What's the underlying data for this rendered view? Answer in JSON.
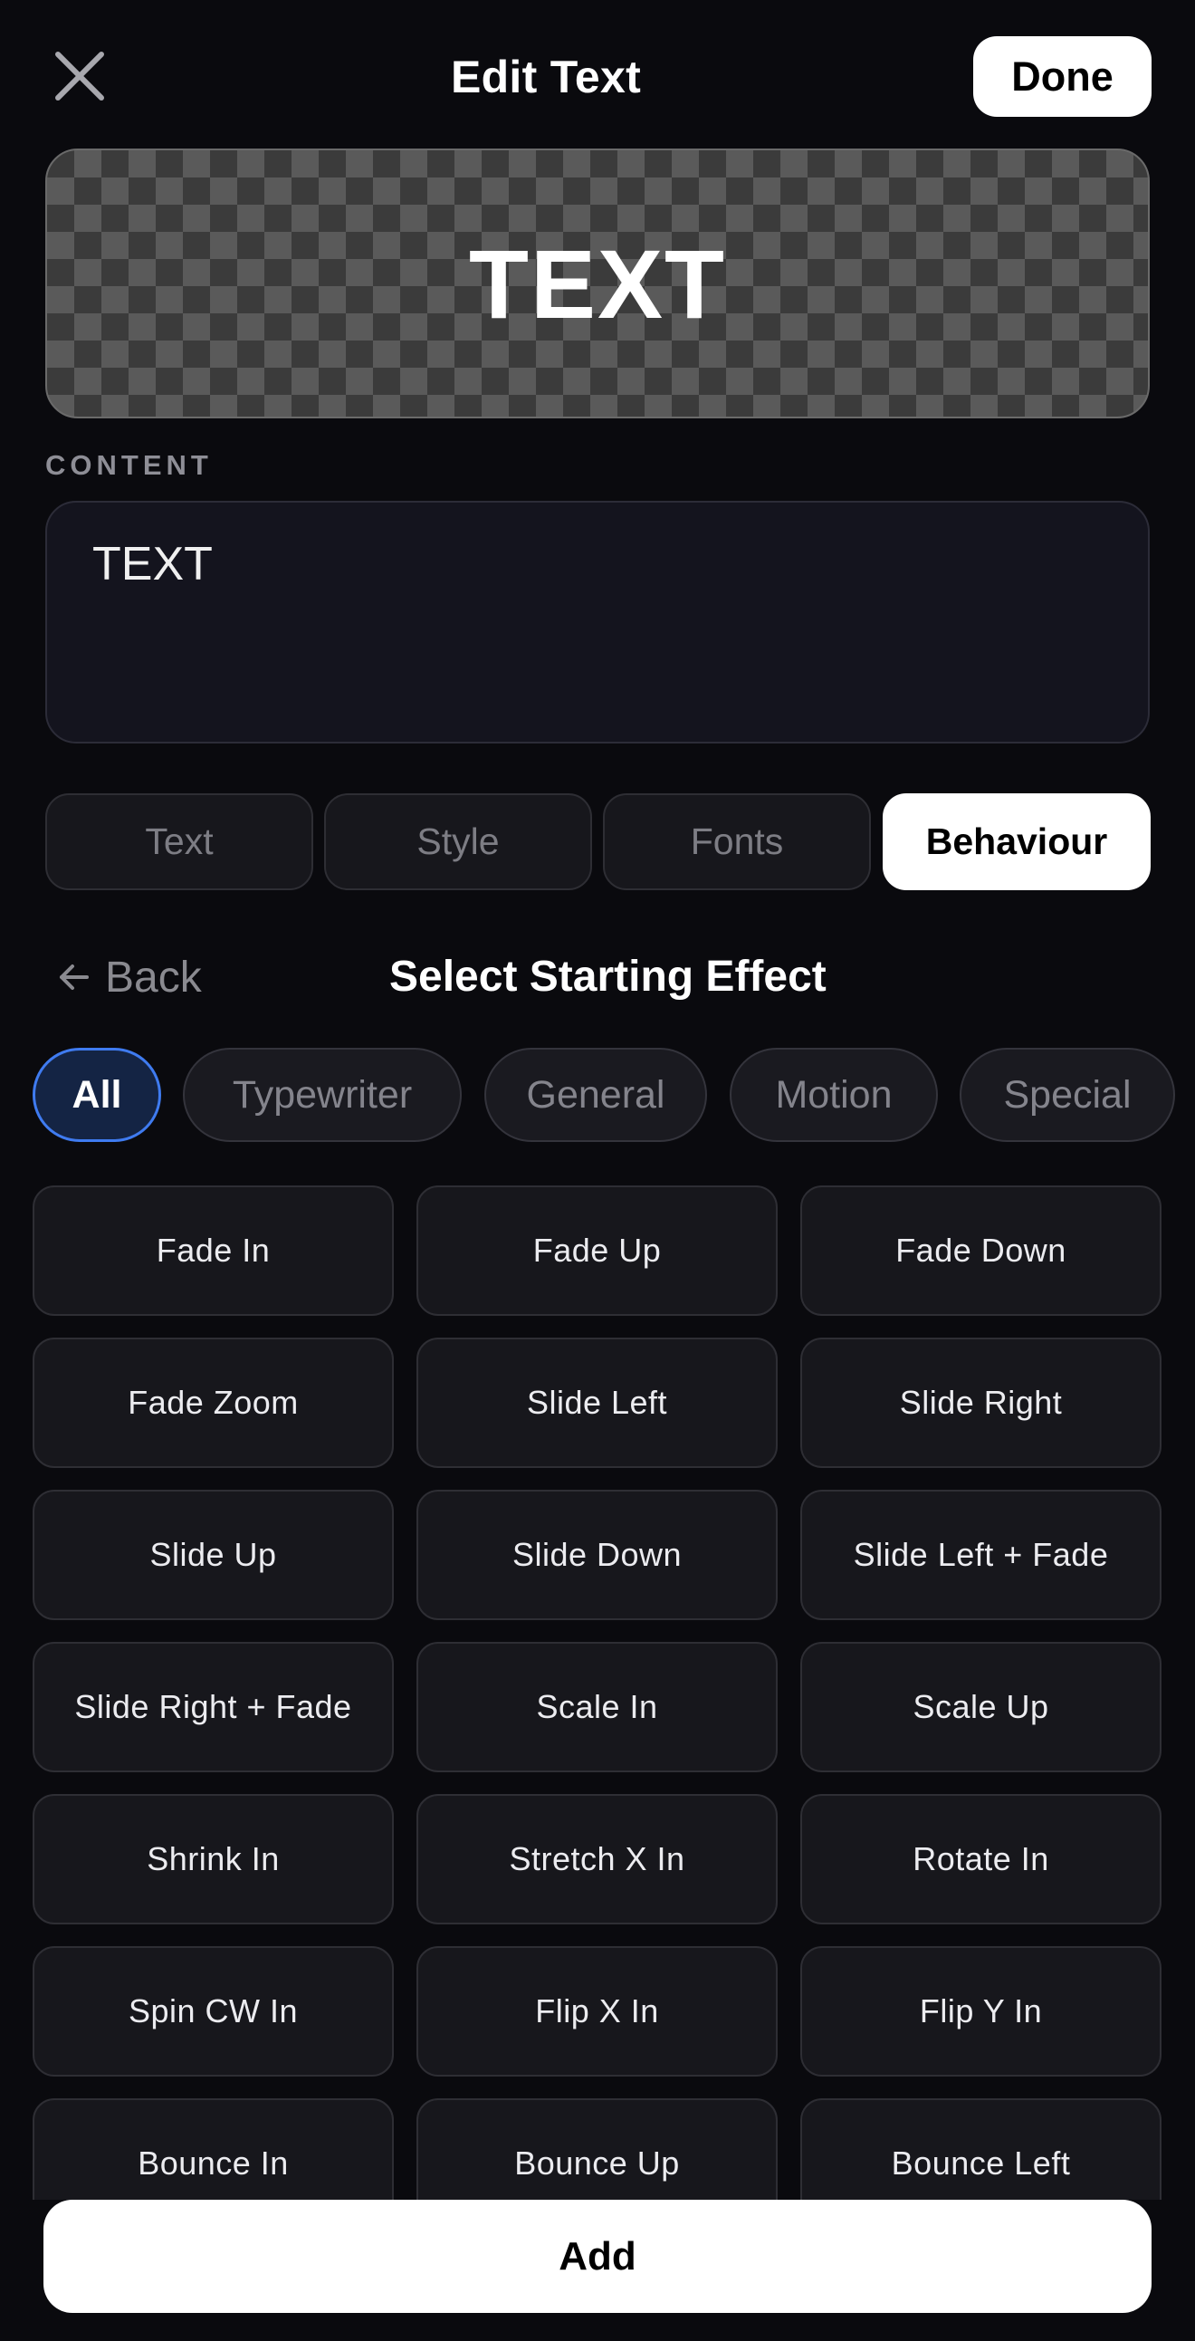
{
  "header": {
    "title": "Edit Text",
    "close_icon": "close-x-icon",
    "done_label": "Done"
  },
  "preview": {
    "text": "TEXT"
  },
  "content": {
    "label": "CONTENT",
    "value": "TEXT"
  },
  "tabs": [
    {
      "label": "Text",
      "active": false
    },
    {
      "label": "Style",
      "active": false
    },
    {
      "label": "Fonts",
      "active": false
    },
    {
      "label": "Behaviour",
      "active": true
    }
  ],
  "effects_panel": {
    "back_icon": "arrow-left-icon",
    "back_label": "Back",
    "title": "Select Starting Effect",
    "filters": [
      {
        "label": "All",
        "active": true
      },
      {
        "label": "Typewriter",
        "active": false
      },
      {
        "label": "General",
        "active": false
      },
      {
        "label": "Motion",
        "active": false
      },
      {
        "label": "Special",
        "active": false
      }
    ],
    "effects": [
      "Fade In",
      "Fade Up",
      "Fade Down",
      "Fade Zoom",
      "Slide Left",
      "Slide Right",
      "Slide Up",
      "Slide Down",
      "Slide Left + Fade",
      "Slide Right + Fade",
      "Scale In",
      "Scale Up",
      "Shrink In",
      "Stretch X In",
      "Rotate In",
      "Spin CW In",
      "Flip X In",
      "Flip Y In",
      "Bounce In",
      "Bounce Up",
      "Bounce Left"
    ]
  },
  "footer": {
    "add_label": "Add"
  },
  "colors": {
    "background": "#0a0a0e",
    "accent_chip_border": "#3f7bf0",
    "accent_chip_fill": "#142444"
  }
}
